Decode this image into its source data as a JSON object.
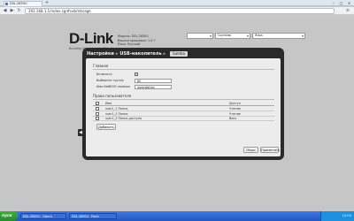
{
  "browser": {
    "tab_title": "DSL-2650U",
    "new_tab": "+",
    "url": "192.168.1.1/index.cgi#usb/storage",
    "back_icon": "arrow-left-icon",
    "forward_icon": "arrow-right-icon",
    "reload_icon": "reload-icon",
    "menu_icon": "menu-icon",
    "win_min": "–",
    "win_max": "□",
    "win_close": "✕"
  },
  "header": {
    "logo": "D-Link",
    "tagline": "Building Networks for People",
    "device_info": [
      "Модель: DSL-2650U",
      "Версия прошивки: 1.0.7",
      "Язык: Русский"
    ],
    "selects": [
      "",
      "Система",
      "Язык"
    ]
  },
  "panel": {
    "breadcrumb": [
      "Настройки",
      "USB-накопитель"
    ],
    "subtab": "Samba",
    "general_title": "Главная",
    "enable_label": "Включить",
    "workgroup_label": "Выберите группу",
    "workgroup_value": "80",
    "netbios_label": "Имя NetBIOS сервера",
    "netbios_value": "workstation",
    "rights_title": "Права пользователя",
    "table": {
      "col_name": "Имя",
      "col_access": "Доступ",
      "rows": [
        {
          "name": "user1_1 Папка",
          "access": "Чтение"
        },
        {
          "name": "user1_2 Папка",
          "access": "Чтение"
        },
        {
          "name": "user1_3 Папка доступа",
          "access": "Весь"
        }
      ]
    },
    "add_button": "Добавить",
    "clear_button": "Сброс",
    "apply_button": "Применить"
  },
  "taskbar": {
    "start": "пуск",
    "tasks": [
      "DSL-2650U - Opera",
      "DSL-2650U - Paint"
    ],
    "clock": "12:00"
  }
}
